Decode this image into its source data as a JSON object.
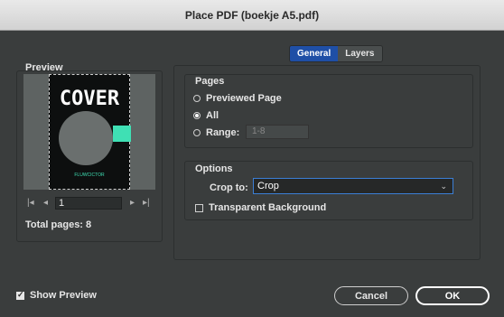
{
  "window": {
    "title": "Place PDF (boekje A5.pdf)"
  },
  "preview": {
    "label": "Preview",
    "cover_title": "COVER",
    "cover_footer": "FLUWCICTOR",
    "page_field_value": "1",
    "total_pages_label": "Total pages: 8",
    "nav_icons": [
      "first-page-icon",
      "prev-page-icon",
      "next-page-icon",
      "last-page-icon"
    ]
  },
  "tabs": [
    {
      "label": "General",
      "active": true
    },
    {
      "label": "Layers",
      "active": false
    }
  ],
  "pages_group": {
    "title": "Pages",
    "options": [
      {
        "label": "Previewed Page",
        "checked": false
      },
      {
        "label": "All",
        "checked": true
      },
      {
        "label": "Range:",
        "checked": false
      }
    ],
    "range_placeholder": "1-8"
  },
  "options_group": {
    "title": "Options",
    "crop_label": "Crop to:",
    "crop_value": "Crop",
    "transparent_bg_label": "Transparent Background",
    "transparent_bg_checked": false
  },
  "footer": {
    "show_preview_label": "Show Preview",
    "show_preview_checked": true,
    "cancel_label": "Cancel",
    "ok_label": "OK"
  },
  "colors": {
    "accent": "#1f4fa6",
    "cover_teal": "#3fe0b4",
    "dialog_bg": "#3a3d3d"
  }
}
